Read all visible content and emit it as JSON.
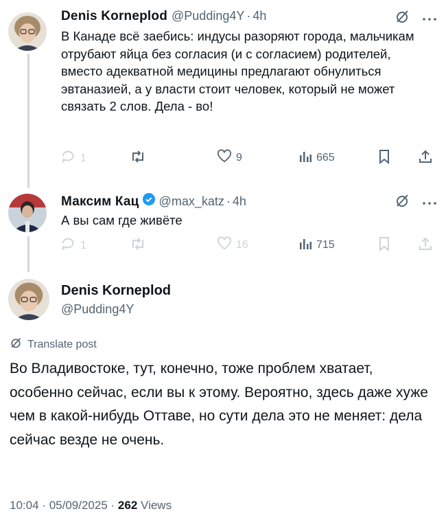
{
  "reply_context": [
    {
      "author_name": "Denis Korneplod",
      "author_handle": "@Pudding4Y",
      "time": "4h",
      "text": "В Канаде всё заебись: индусы разоряют города, мальчикам отрубают яйца без согласия (и с согласием) родителей, вместо адекватной медицины предлагают обнулиться эвтаназией, а у власти стоит человек, который не может связать 2 слов. Дела - во!",
      "replies": "1",
      "likes": "9",
      "views": "665"
    },
    {
      "author_name": "Максим Кац",
      "author_handle": "@max_katz",
      "time": "4h",
      "verified": true,
      "text": "А вы сам где живёте",
      "replies": "1",
      "likes": "16",
      "views": "715"
    }
  ],
  "main_post": {
    "author_name": "Denis Korneplod",
    "author_handle": "@Pudding4Y",
    "translate_label": "Translate post",
    "text": "Во Владивостоке, тут, конечно, тоже проблем хватает, особенно сейчас, если вы к этому. Вероятно, здесь даже хуже чем в какой-нибудь Оттаве, но сути дела это не меняет: дела сейчас везде не очень.",
    "time": "10:04",
    "date": "05/09/2025",
    "views_count": "262",
    "views_label": "Views"
  },
  "separator": "·",
  "colors": {
    "accent": "#1d9bf0",
    "secondary": "#536471",
    "thread_line": "#cfd9de"
  }
}
